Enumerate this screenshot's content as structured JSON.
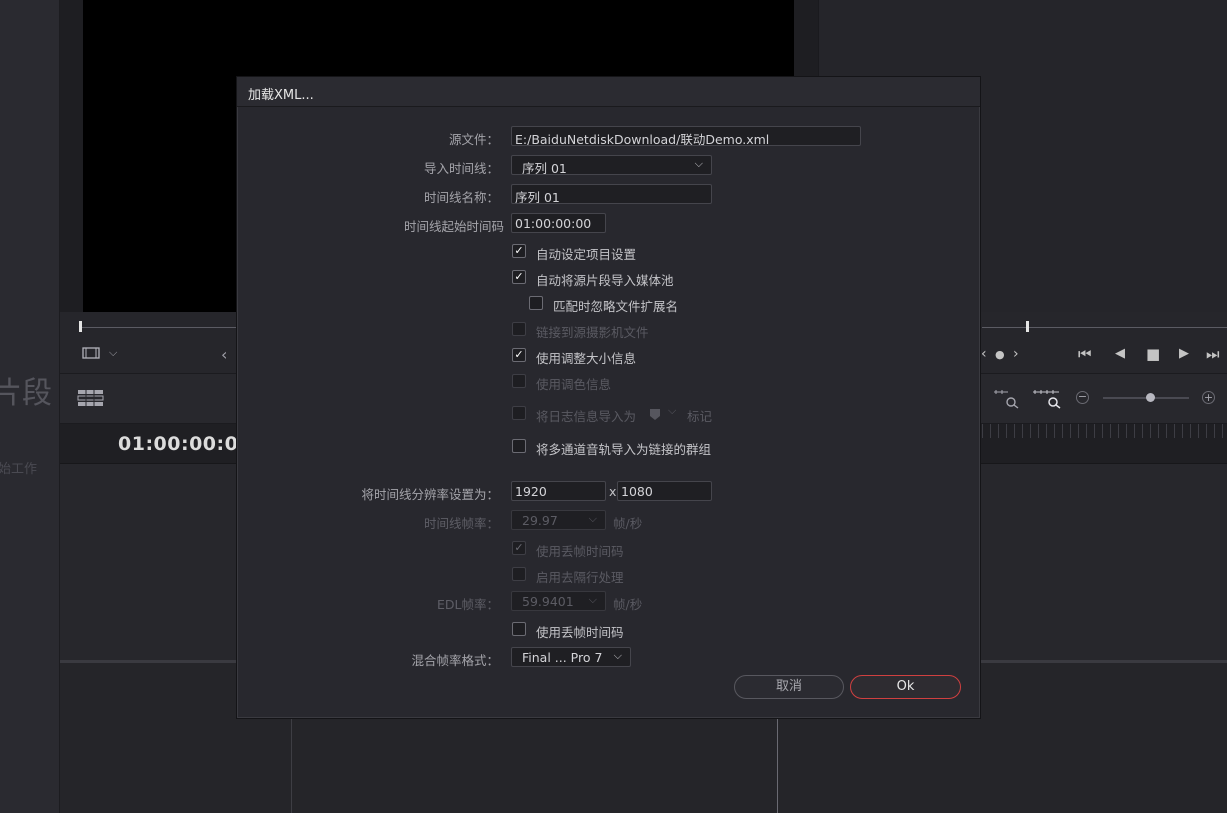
{
  "background": {
    "left_title": "片段",
    "left_subtitle": "始工作",
    "timecode": "01:00:00:00",
    "transport": {
      "skip_back": "⏮",
      "prev_frame": "◀",
      "stop": "■",
      "play": "▶",
      "skip_forward": "⏭",
      "nav_left": "‹",
      "nav_dot": "●",
      "nav_right": "›",
      "zoom_out": "−",
      "zoom_in": "+"
    },
    "zoom_level": 0.55
  },
  "dialog": {
    "title": "加载XML...",
    "source_file": {
      "label": "源文件：",
      "value": "E:/BaiduNetdiskDownload/联动Demo.xml"
    },
    "import_timeline": {
      "label": "导入时间线：",
      "value": "序列 01"
    },
    "timeline_name": {
      "label": "时间线名称：",
      "value": "序列 01"
    },
    "timeline_start_tc": {
      "label": "时间线起始时间码",
      "value": "01:00:00:00"
    },
    "checkboxes": [
      {
        "label": "自动设定项目设置",
        "checked": true,
        "enabled": true
      },
      {
        "label": "自动将源片段导入媒体池",
        "checked": true,
        "enabled": true
      },
      {
        "label": "匹配时忽略文件扩展名",
        "checked": false,
        "enabled": true
      },
      {
        "label": "链接到源摄影机文件",
        "checked": false,
        "enabled": false
      },
      {
        "label": "使用调整大小信息",
        "checked": true,
        "enabled": true
      },
      {
        "label": "使用调色信息",
        "checked": false,
        "enabled": false
      },
      {
        "label": "将日志信息导入为",
        "checked": false,
        "enabled": false
      },
      {
        "label": "将多通道音轨导入为链接的群组",
        "checked": false,
        "enabled": true
      }
    ],
    "marker_suffix": "标记",
    "resolution": {
      "label": "将时间线分辨率设置为：",
      "width": "1920",
      "separator": "x",
      "height": "1080"
    },
    "frame_rate": {
      "label": "时间线帧率：",
      "value": "29.97",
      "unit": "帧/秒"
    },
    "drop_frame_tc_1": {
      "label": "使用丢帧时间码",
      "checked": true,
      "enabled": false
    },
    "deinterlace": {
      "label": "启用去隔行处理",
      "checked": false,
      "enabled": false
    },
    "edl_frame_rate": {
      "label": "EDL帧率：",
      "value": "59.9401",
      "unit": "帧/秒"
    },
    "drop_frame_tc_2": {
      "label": "使用丢帧时间码",
      "checked": false,
      "enabled": true
    },
    "mixed_frame_rate": {
      "label": "混合帧率格式：",
      "value": "Final ... Pro 7"
    },
    "buttons": {
      "cancel": "取消",
      "ok": "Ok"
    },
    "icons": {
      "check": "✓",
      "chevron": "⌵"
    }
  }
}
